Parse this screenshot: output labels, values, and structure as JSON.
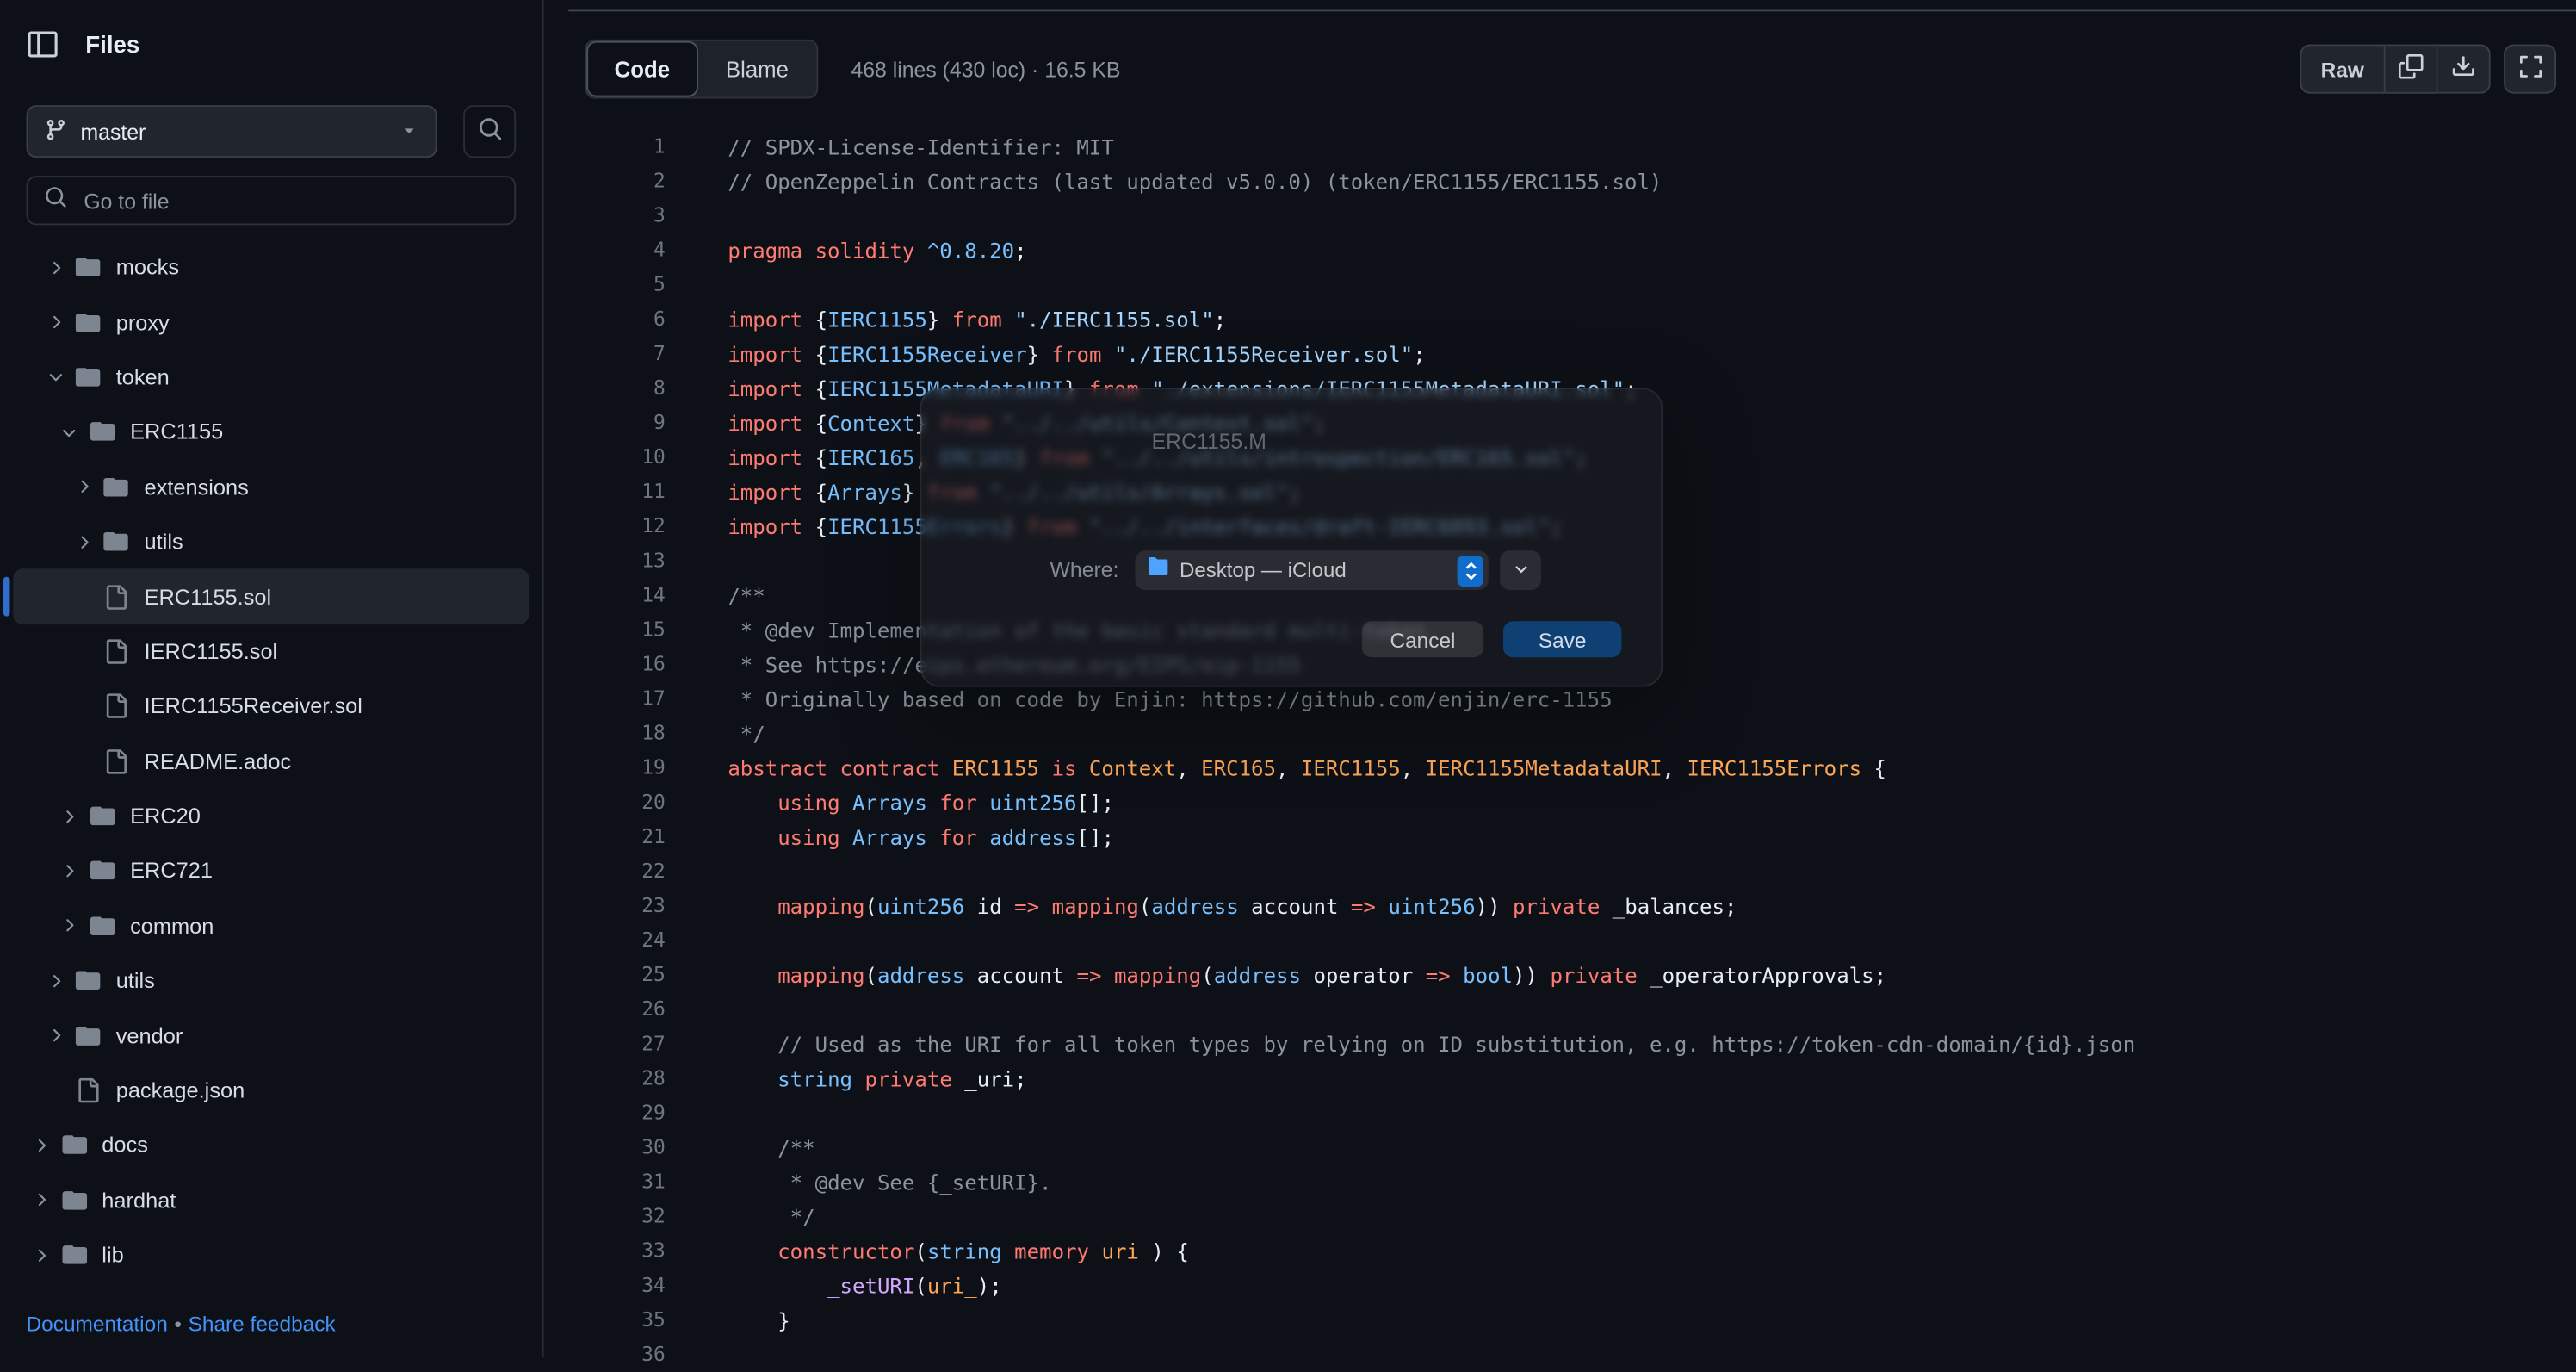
{
  "colors": {
    "accent_blue": "#316dca",
    "link_blue": "#4493f8",
    "background": "#0d1117",
    "border": "#30363d"
  },
  "sidebar": {
    "title": "Files",
    "branch": {
      "name": "master"
    },
    "search_placeholder": "Go to file",
    "tree": [
      {
        "label": "mocks",
        "type": "folder",
        "state": "collapsed",
        "indent": 1
      },
      {
        "label": "proxy",
        "type": "folder",
        "state": "collapsed",
        "indent": 1
      },
      {
        "label": "token",
        "type": "folder",
        "state": "expanded",
        "indent": 1
      },
      {
        "label": "ERC1155",
        "type": "folder",
        "state": "expanded",
        "indent": 2
      },
      {
        "label": "extensions",
        "type": "folder",
        "state": "collapsed",
        "indent": 3
      },
      {
        "label": "utils",
        "type": "folder",
        "state": "collapsed",
        "indent": 3
      },
      {
        "label": "ERC1155.sol",
        "type": "file",
        "selected": true,
        "indent": 3
      },
      {
        "label": "IERC1155.sol",
        "type": "file",
        "indent": 3
      },
      {
        "label": "IERC1155Receiver.sol",
        "type": "file",
        "indent": 3
      },
      {
        "label": "README.adoc",
        "type": "file",
        "indent": 3
      },
      {
        "label": "ERC20",
        "type": "folder",
        "state": "collapsed",
        "indent": 2
      },
      {
        "label": "ERC721",
        "type": "folder",
        "state": "collapsed",
        "indent": 2
      },
      {
        "label": "common",
        "type": "folder",
        "state": "collapsed",
        "indent": 2
      },
      {
        "label": "utils",
        "type": "folder",
        "state": "collapsed",
        "indent": 1
      },
      {
        "label": "vendor",
        "type": "folder",
        "state": "collapsed",
        "indent": 1
      },
      {
        "label": "package.json",
        "type": "file",
        "indent": 1
      },
      {
        "label": "docs",
        "type": "folder",
        "state": "collapsed",
        "indent": 0
      },
      {
        "label": "hardhat",
        "type": "folder",
        "state": "collapsed",
        "indent": 0
      },
      {
        "label": "lib",
        "type": "folder",
        "state": "collapsed",
        "indent": 0
      }
    ],
    "footer": {
      "doc_link": "Documentation",
      "separator": "•",
      "feedback_link": "Share feedback"
    }
  },
  "toolbar": {
    "tabs": [
      {
        "label": "Code",
        "active": true
      },
      {
        "label": "Blame",
        "active": false
      }
    ],
    "meta": "468 lines (430 loc) · 16.5 KB",
    "raw_label": "Raw"
  },
  "dialog": {
    "filename": "ERC1155.M",
    "where_label": "Where:",
    "where_value": "Desktop — iCloud",
    "cancel_label": "Cancel",
    "save_label": "Save"
  },
  "code": {
    "lines": [
      {
        "n": 1,
        "t": [
          [
            "c",
            "// SPDX-License-Identifier: MIT"
          ]
        ]
      },
      {
        "n": 2,
        "t": [
          [
            "c",
            "// OpenZeppelin Contracts (last updated v5.0.0) (token/ERC1155/ERC1155.sol)"
          ]
        ]
      },
      {
        "n": 3,
        "t": []
      },
      {
        "n": 4,
        "t": [
          [
            "k",
            "pragma solidity "
          ],
          [
            "e",
            "^0.8.20"
          ],
          [
            "p",
            ";"
          ]
        ]
      },
      {
        "n": 5,
        "t": []
      },
      {
        "n": 6,
        "t": [
          [
            "k",
            "import"
          ],
          [
            "p",
            " {"
          ],
          [
            "e",
            "IERC1155"
          ],
          [
            "p",
            "} "
          ],
          [
            "k",
            "from"
          ],
          [
            "p",
            " "
          ],
          [
            "s",
            "\"./IERC1155.sol\""
          ],
          [
            "p",
            ";"
          ]
        ]
      },
      {
        "n": 7,
        "t": [
          [
            "k",
            "import"
          ],
          [
            "p",
            " {"
          ],
          [
            "e",
            "IERC1155Receiver"
          ],
          [
            "p",
            "} "
          ],
          [
            "k",
            "from"
          ],
          [
            "p",
            " "
          ],
          [
            "s",
            "\"./IERC1155Receiver.sol\""
          ],
          [
            "p",
            ";"
          ]
        ]
      },
      {
        "n": 8,
        "t": [
          [
            "k",
            "import"
          ],
          [
            "p",
            " {"
          ],
          [
            "e",
            "IERC1155MetadataURI"
          ],
          [
            "p",
            "} "
          ],
          [
            "k",
            "from"
          ],
          [
            "p",
            " "
          ],
          [
            "s",
            "\"./extensions/IERC1155MetadataURI.sol\""
          ],
          [
            "p",
            ";"
          ]
        ]
      },
      {
        "n": 9,
        "t": [
          [
            "k",
            "import"
          ],
          [
            "p",
            " {"
          ],
          [
            "e",
            "Context"
          ],
          [
            "p",
            "} "
          ],
          [
            "k",
            "from"
          ],
          [
            "p",
            " "
          ],
          [
            "s",
            "\"../../utils/Context.sol\""
          ],
          [
            "p",
            ";"
          ]
        ]
      },
      {
        "n": 10,
        "t": [
          [
            "k",
            "import"
          ],
          [
            "p",
            " {"
          ],
          [
            "e",
            "IERC165"
          ],
          [
            "p",
            ", "
          ],
          [
            "e",
            "ERC165"
          ],
          [
            "p",
            "} "
          ],
          [
            "k",
            "from"
          ],
          [
            "p",
            " "
          ],
          [
            "s",
            "\"../../utils/introspection/ERC165.sol\""
          ],
          [
            "p",
            ";"
          ]
        ]
      },
      {
        "n": 11,
        "t": [
          [
            "k",
            "import"
          ],
          [
            "p",
            " {"
          ],
          [
            "e",
            "Arrays"
          ],
          [
            "p",
            "} "
          ],
          [
            "k",
            "from"
          ],
          [
            "p",
            " "
          ],
          [
            "s",
            "\"../../utils/Arrays.sol\""
          ],
          [
            "p",
            ";"
          ]
        ]
      },
      {
        "n": 12,
        "t": [
          [
            "k",
            "import"
          ],
          [
            "p",
            " {"
          ],
          [
            "e",
            "IERC1155Errors"
          ],
          [
            "p",
            "} "
          ],
          [
            "k",
            "from"
          ],
          [
            "p",
            " "
          ],
          [
            "s",
            "\"../../interfaces/draft-IERC6093.sol\""
          ],
          [
            "p",
            ";"
          ]
        ]
      },
      {
        "n": 13,
        "t": []
      },
      {
        "n": 14,
        "t": [
          [
            "c",
            "/**"
          ]
        ]
      },
      {
        "n": 15,
        "t": [
          [
            "c",
            " * @dev Implementation of the basic standard multi-token."
          ]
        ]
      },
      {
        "n": 16,
        "t": [
          [
            "c",
            " * See https://eips.ethereum.org/EIPS/eip-1155"
          ]
        ]
      },
      {
        "n": 17,
        "t": [
          [
            "c",
            " * Originally based on code by Enjin: https://github.com/enjin/erc-1155"
          ]
        ]
      },
      {
        "n": 18,
        "t": [
          [
            "c",
            " */"
          ]
        ]
      },
      {
        "n": 19,
        "t": [
          [
            "k",
            "abstract contract "
          ],
          [
            "o",
            "ERC1155"
          ],
          [
            "k",
            " is "
          ],
          [
            "o",
            "Context"
          ],
          [
            "p",
            ", "
          ],
          [
            "o",
            "ERC165"
          ],
          [
            "p",
            ", "
          ],
          [
            "o",
            "IERC1155"
          ],
          [
            "p",
            ", "
          ],
          [
            "o",
            "IERC1155MetadataURI"
          ],
          [
            "p",
            ", "
          ],
          [
            "o",
            "IERC1155Errors"
          ],
          [
            "p",
            " {"
          ]
        ]
      },
      {
        "n": 20,
        "t": [
          [
            "p",
            "    "
          ],
          [
            "k",
            "using "
          ],
          [
            "e",
            "Arrays"
          ],
          [
            "k",
            " for "
          ],
          [
            "e",
            "uint256"
          ],
          [
            "p",
            "[];"
          ]
        ]
      },
      {
        "n": 21,
        "t": [
          [
            "p",
            "    "
          ],
          [
            "k",
            "using "
          ],
          [
            "e",
            "Arrays"
          ],
          [
            "k",
            " for "
          ],
          [
            "e",
            "address"
          ],
          [
            "p",
            "[];"
          ]
        ]
      },
      {
        "n": 22,
        "t": []
      },
      {
        "n": 23,
        "t": [
          [
            "p",
            "    "
          ],
          [
            "k",
            "mapping"
          ],
          [
            "p",
            "("
          ],
          [
            "e",
            "uint256"
          ],
          [
            "p",
            " id "
          ],
          [
            "k",
            "=>"
          ],
          [
            "p",
            " "
          ],
          [
            "k",
            "mapping"
          ],
          [
            "p",
            "("
          ],
          [
            "e",
            "address"
          ],
          [
            "p",
            " account "
          ],
          [
            "k",
            "=>"
          ],
          [
            "p",
            " "
          ],
          [
            "e",
            "uint256"
          ],
          [
            "p",
            ")) "
          ],
          [
            "k",
            "private"
          ],
          [
            "p",
            " _balances;"
          ]
        ]
      },
      {
        "n": 24,
        "t": []
      },
      {
        "n": 25,
        "t": [
          [
            "p",
            "    "
          ],
          [
            "k",
            "mapping"
          ],
          [
            "p",
            "("
          ],
          [
            "e",
            "address"
          ],
          [
            "p",
            " account "
          ],
          [
            "k",
            "=>"
          ],
          [
            "p",
            " "
          ],
          [
            "k",
            "mapping"
          ],
          [
            "p",
            "("
          ],
          [
            "e",
            "address"
          ],
          [
            "p",
            " operator "
          ],
          [
            "k",
            "=>"
          ],
          [
            "p",
            " "
          ],
          [
            "e",
            "bool"
          ],
          [
            "p",
            ")) "
          ],
          [
            "k",
            "private"
          ],
          [
            "p",
            " _operatorApprovals;"
          ]
        ]
      },
      {
        "n": 26,
        "t": []
      },
      {
        "n": 27,
        "t": [
          [
            "p",
            "    "
          ],
          [
            "c",
            "// Used as the URI for all token types by relying on ID substitution, e.g. https://token-cdn-domain/{id}.json"
          ]
        ]
      },
      {
        "n": 28,
        "t": [
          [
            "p",
            "    "
          ],
          [
            "e",
            "string"
          ],
          [
            "p",
            " "
          ],
          [
            "k",
            "private"
          ],
          [
            "p",
            " _uri;"
          ]
        ]
      },
      {
        "n": 29,
        "t": []
      },
      {
        "n": 30,
        "t": [
          [
            "p",
            "    "
          ],
          [
            "c",
            "/**"
          ]
        ]
      },
      {
        "n": 31,
        "t": [
          [
            "p",
            "    "
          ],
          [
            "c",
            " * @dev See {_setURI}."
          ]
        ]
      },
      {
        "n": 32,
        "t": [
          [
            "p",
            "    "
          ],
          [
            "c",
            " */"
          ]
        ]
      },
      {
        "n": 33,
        "t": [
          [
            "p",
            "    "
          ],
          [
            "k",
            "constructor"
          ],
          [
            "p",
            "("
          ],
          [
            "e",
            "string"
          ],
          [
            "p",
            " "
          ],
          [
            "k",
            "memory"
          ],
          [
            "p",
            " "
          ],
          [
            "o",
            "uri_"
          ],
          [
            "p",
            ") {"
          ]
        ]
      },
      {
        "n": 34,
        "t": [
          [
            "p",
            "        "
          ],
          [
            "f",
            "_setURI"
          ],
          [
            "p",
            "("
          ],
          [
            "o",
            "uri_"
          ],
          [
            "p",
            ");"
          ]
        ]
      },
      {
        "n": 35,
        "t": [
          [
            "p",
            "    }"
          ]
        ]
      },
      {
        "n": 36,
        "t": []
      }
    ]
  }
}
